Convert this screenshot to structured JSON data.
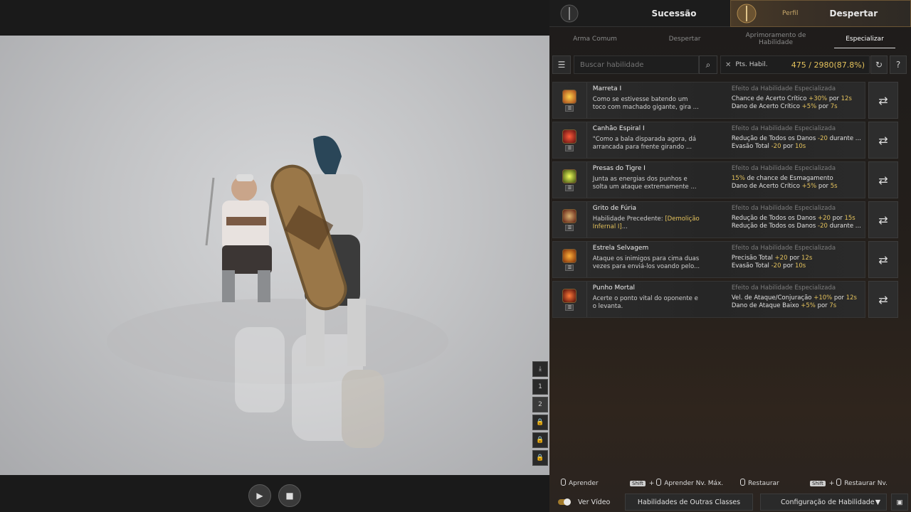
{
  "tabs": {
    "sucessao": "Sucessão",
    "perfil": "Perfil",
    "despertar": "Despertar"
  },
  "subtabs": [
    "Arma Comum",
    "Despertar",
    "Aprimoramento de Habilidade",
    "Especializar"
  ],
  "search": {
    "placeholder": "Buscar habilidade"
  },
  "points": {
    "label": "Pts. Habil.",
    "value": "475 / 2980(87.8%)"
  },
  "header_effect": "Efeito da Habilidade Especializada",
  "skills": [
    {
      "name": "Marreta I",
      "desc1": "Como se estivesse batendo um",
      "desc2": "toco com machado gigante, gira ...",
      "e1a": "Chance de Acerto Crítico ",
      "e1b": "+30%",
      "e1c": " por ",
      "e1d": "12s",
      "e2a": "Dano de Acerto Crítico ",
      "e2b": "+5%",
      "e2c": " por ",
      "e2d": "7s"
    },
    {
      "name": "Canhão Espiral I",
      "desc1": "\"Como a bala disparada agora, dá",
      "desc2": "arrancada para frente girando ...",
      "e1a": "Redução de Todos os Danos ",
      "e1b": "-20",
      "e1c": " durante ...",
      "e1d": "",
      "e2a": "Evasão Total ",
      "e2b": "-20",
      "e2c": " por ",
      "e2d": "10s"
    },
    {
      "name": "Presas do Tigre I",
      "desc1": "Junta as energias dos punhos e",
      "desc2": "solta um ataque extremamente ...",
      "e1a": "",
      "e1b": "15%",
      "e1c": " de chance de Esmagamento",
      "e1d": "",
      "e2a": "Dano de Acerto Crítico ",
      "e2b": "+5%",
      "e2c": " por ",
      "e2d": "5s"
    },
    {
      "name": "Grito de Fúria",
      "desc1": "Habilidade Precedente: ",
      "desc1hl": "[Demolição",
      "desc2hl": "Infernal I]",
      "desc2": "...",
      "e1a": "Redução de Todos os Danos ",
      "e1b": "+20",
      "e1c": " por ",
      "e1d": "15s",
      "e2a": "Redução de Todos os Danos ",
      "e2b": "-20",
      "e2c": " durante ...",
      "e2d": ""
    },
    {
      "name": "Estrela Selvagem",
      "desc1": "Ataque os inimigos para cima duas",
      "desc2": "vezes para enviá-los voando pelo...",
      "e1a": "Precisão Total ",
      "e1b": "+20",
      "e1c": " por ",
      "e1d": "12s",
      "e2a": "Evasão Total ",
      "e2b": "-20",
      "e2c": " por ",
      "e2d": "10s"
    },
    {
      "name": "Punho Mortal",
      "desc1": "Acerte o ponto vital do oponente e",
      "desc2": "o levanta.",
      "e1a": "Vel. de Ataque/Conjuração ",
      "e1b": "+10%",
      "e1c": " por ",
      "e1d": "12s",
      "e2a": "Dano de Ataque Baixo ",
      "e2b": "+5%",
      "e2c": " por ",
      "e2d": "7s"
    }
  ],
  "legend": {
    "learn": "Aprender",
    "shift": "Shift",
    "learn_max": "Aprender Nv. Máx.",
    "restore": "Restaurar",
    "restore_lv": "Restaurar Nv."
  },
  "footer": {
    "video": "Ver Vídeo",
    "other_classes": "Habilidades de Outras Classes",
    "config": "Configuração de Habilidade"
  },
  "side_tools": [
    "1",
    "2"
  ]
}
